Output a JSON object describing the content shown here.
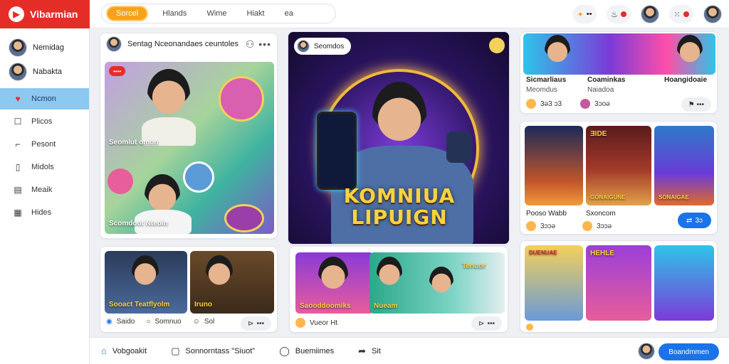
{
  "brand": {
    "name": "Vibarmian",
    "logo_icon": "brand-play-icon"
  },
  "tabs": [
    {
      "label": "Sorcel",
      "active": true
    },
    {
      "label": "Hlands"
    },
    {
      "label": "Wime"
    },
    {
      "label": "Hiakt"
    },
    {
      "label": "ea"
    }
  ],
  "top_actions": {
    "badge_count": "3"
  },
  "sidebar": {
    "users": [
      {
        "label": "Nemidag"
      },
      {
        "label": "Nabakta"
      }
    ],
    "items": [
      {
        "label": "Ncmon",
        "icon": "heart-icon",
        "active": true
      },
      {
        "label": "Plicos",
        "icon": "square-icon"
      },
      {
        "label": "Pesont",
        "icon": "file-icon"
      },
      {
        "label": "Midols",
        "icon": "page-icon"
      },
      {
        "label": "Meaik",
        "icon": "grid-icon"
      },
      {
        "label": "Hides",
        "icon": "list-icon"
      }
    ]
  },
  "card1": {
    "header": "Sentag Nceonandaes ceuntoles",
    "badge": "••••",
    "overlay_top": "Seomlut omon",
    "overlay_bottom": "Scomdoot Nteoin"
  },
  "feature": {
    "header": "Seomdos",
    "title_line1": "KOMNIUA",
    "title_line2": "LIPUIGN"
  },
  "right_top": {
    "names": [
      "Sicmarliaus",
      "Coaminkas",
      "Hoangidoaie"
    ],
    "subs": [
      "Meomdus",
      "Naiadoa"
    ],
    "stat1": "3ə3 ɔ3",
    "stat2": "3ɔoə"
  },
  "right_mid": {
    "thumb_labels": [
      "ƎIDE",
      "GONAIGUNE",
      "SONAIGAE"
    ],
    "name1": "Pooso Wabb",
    "name2": "Sxoncom",
    "stat1": "3ɔɔə",
    "stat2": "3ɔɔə",
    "cta": "3ɔ"
  },
  "card_bl": {
    "caption1": "Sooact Teatflyolm",
    "caption2": "Iruno",
    "footer": [
      "Saido",
      "Somnuo",
      "Sol"
    ],
    "footer_btn": "•••"
  },
  "card_bm": {
    "caption1": "Saooddoomiks",
    "caption2": "Nueam",
    "sticker": "Tenuor",
    "footer": "Vueor Ht",
    "footer_btn": "•••"
  },
  "card_br": {
    "labels": [
      "DUENUAE",
      "HEHLE"
    ]
  },
  "bottom_bar": {
    "items": [
      {
        "label": "Vobgoakit",
        "icon": "home-icon"
      },
      {
        "label": "Sonnorntass \"Siuot\"",
        "icon": "chat-square-icon"
      },
      {
        "label": "Buemiimes",
        "icon": "chat-bubble-icon"
      },
      {
        "label": "Sit",
        "icon": "share-icon"
      }
    ],
    "cta": "Boandmmen"
  },
  "colors": {
    "brand": "#e52d27",
    "active_tab": "#f7a21b",
    "sidebar_active": "#8cc8f0",
    "cta": "#1a73e8"
  }
}
